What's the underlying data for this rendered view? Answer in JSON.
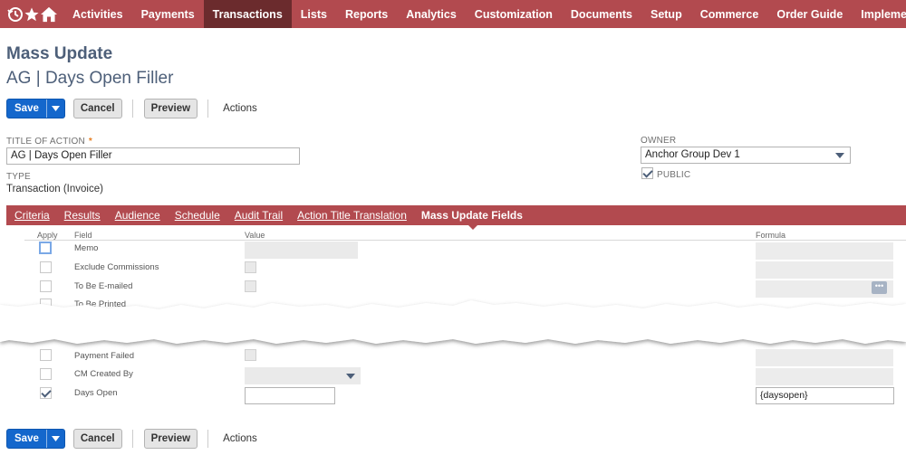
{
  "nav": {
    "items": [
      "Activities",
      "Payments",
      "Transactions",
      "Lists",
      "Reports",
      "Analytics",
      "Customization",
      "Documents",
      "Setup",
      "Commerce",
      "Order Guide",
      "Implementation"
    ],
    "active": "Transactions",
    "icons": [
      "recent-icon",
      "star-icon",
      "home-icon"
    ]
  },
  "page": {
    "title": "Mass Update",
    "record_title": "AG | Days Open Filler"
  },
  "toolbar": {
    "save": "Save",
    "cancel": "Cancel",
    "preview": "Preview",
    "actions": "Actions"
  },
  "form": {
    "title_label": "TITLE OF ACTION",
    "title_value": "AG | Days Open Filler",
    "type_label": "TYPE",
    "type_value": "Transaction (Invoice)",
    "owner_label": "OWNER",
    "owner_value": "Anchor Group Dev 1",
    "public_label": "PUBLIC",
    "public_checked": true
  },
  "subtabs": [
    "Criteria",
    "Results",
    "Audience",
    "Schedule",
    "Audit Trail",
    "Action Title Translation",
    "Mass Update Fields"
  ],
  "table": {
    "headers": {
      "apply": "Apply",
      "field": "Field",
      "value": "Value",
      "formula": "Formula"
    },
    "rows_top": [
      {
        "field": "Memo",
        "value_type": "text"
      },
      {
        "field": "Exclude Commissions",
        "value_type": "checkbox"
      },
      {
        "field": "To Be E-mailed",
        "value_type": "checkbox"
      },
      {
        "field": "To Be Printed",
        "value_type": "checkbox"
      }
    ],
    "rows_bottom": [
      {
        "field": "Payment Failed",
        "value_type": "checkbox"
      },
      {
        "field": "CM Created By",
        "value_type": "select"
      },
      {
        "field": "Days Open",
        "value_type": "text",
        "applied": true,
        "formula": "{daysopen}"
      }
    ]
  }
}
